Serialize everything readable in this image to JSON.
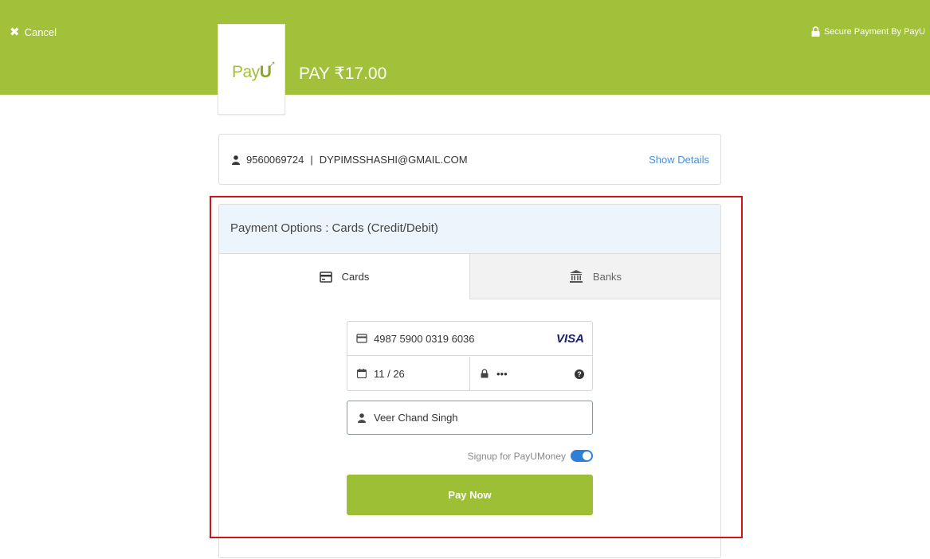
{
  "header": {
    "cancel_label": "Cancel",
    "secure_label": "Secure Payment By PayU",
    "brand_color": "#a2c13a",
    "logo": {
      "text_main": "Pay",
      "text_bold": "U"
    },
    "pay_amount": "PAY ₹17.00"
  },
  "user": {
    "phone": "9560069724",
    "separator": "|",
    "email": "DYPIMSSHASHI@GMAIL.COM",
    "show_details_label": "Show Details"
  },
  "payment": {
    "options_title": "Payment Options : Cards (Credit/Debit)",
    "tabs": [
      {
        "label": "Cards",
        "icon": "card-icon",
        "active": true
      },
      {
        "label": "Banks",
        "icon": "bank-icon",
        "active": false
      }
    ],
    "card_number": "4987 5900 0319 6036",
    "card_brand": "VISA",
    "expiry": "11 / 26",
    "cvv": "•••",
    "name_on_card": "Veer Chand Singh",
    "signup_label": "Signup for PayUMoney",
    "signup_enabled": true,
    "pay_button_label": "Pay Now"
  },
  "colors": {
    "accent_blue": "#2f7fd6",
    "highlight_red": "#d0121b",
    "button_green": "#9cbf36"
  }
}
